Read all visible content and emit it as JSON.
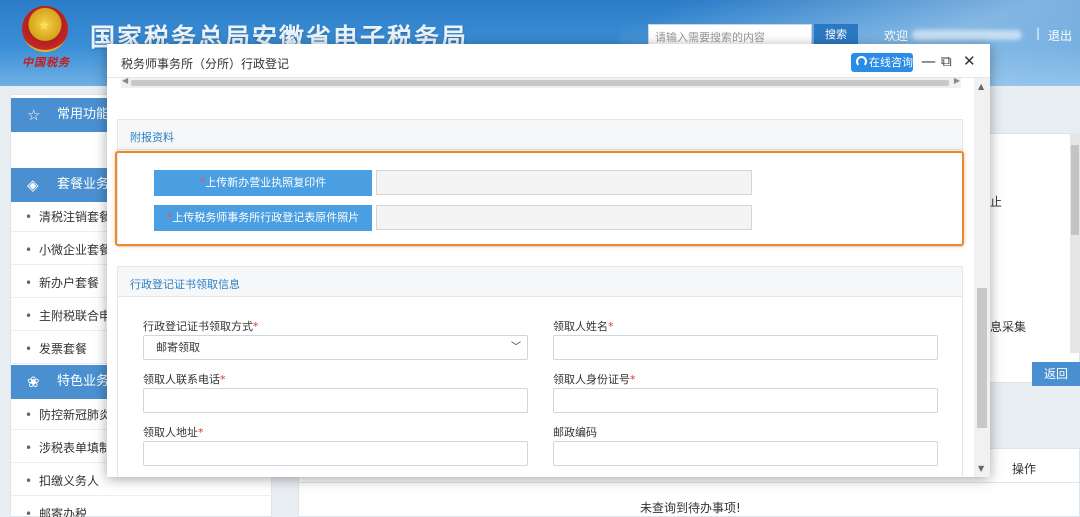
{
  "header": {
    "emblem_text": "中国税务",
    "site_title": "国家税务总局安徽省电子税务局",
    "search_placeholder": "请输入需要搜索的内容",
    "search_button": "搜索",
    "welcome": "欢迎",
    "separator": "|",
    "logout": "退出"
  },
  "sidebar": {
    "sections": [
      {
        "title": "常用功能",
        "icon": "star-icon"
      },
      {
        "title": "套餐业务",
        "icon": "layers-icon"
      },
      {
        "title": "特色业务",
        "icon": "flower-icon"
      }
    ],
    "items": [
      "清税注销套餐",
      "小微企业套餐",
      "新办户套餐",
      "主附税联合申报",
      "发票套餐",
      "防控新冠肺炎",
      "涉税表单填制",
      "扣缴义务人",
      "邮寄办税"
    ]
  },
  "background": {
    "text_1": "止",
    "text_2": "息采集",
    "back_button": "返回",
    "op_label": "操作",
    "empty_message": "未查询到待办事项!"
  },
  "modal": {
    "title": "税务师事务所（分所）行政登记",
    "consult_button": "在线咨询",
    "minimize": "—",
    "restore": "⧉",
    "close": "✕",
    "attachments": {
      "section_title": "附报资料",
      "uploads": [
        {
          "label": "上传新办营业执照复印件",
          "required_mark": "*"
        },
        {
          "label": "上传税务师事务所行政登记表原件照片",
          "required_mark": "*"
        }
      ]
    },
    "certificate": {
      "section_title": "行政登记证书领取信息",
      "fields": {
        "method_label": "行政登记证书领取方式",
        "method_value": "邮寄领取",
        "name_label": "领取人姓名",
        "phone_label": "领取人联系电话",
        "id_label": "领取人身份证号",
        "address_label": "领取人地址",
        "postcode_label": "邮政编码"
      },
      "required_mark": "*"
    }
  },
  "colors": {
    "header_blue": "#2c7cc7",
    "button_blue": "#4a9ee2",
    "highlight_orange": "#e78a2d",
    "section_title_blue": "#2a7fc4",
    "required_red": "#e63232"
  }
}
